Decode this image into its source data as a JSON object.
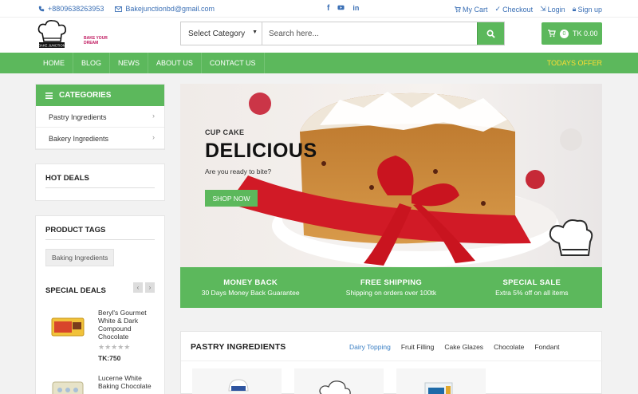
{
  "topbar": {
    "phone": "+8809638263953",
    "email": "Bakejunctionbd@gmail.com",
    "my_cart": "My Cart",
    "checkout": "Checkout",
    "login": "Login",
    "signup": "Sign up"
  },
  "header": {
    "logo_text": "BAKE YOUR DREAM",
    "category_select": "Select Category",
    "search_placeholder": "Search here...",
    "cart_count": "0",
    "cart_total": "TK 0.00"
  },
  "nav": {
    "items": [
      "HOME",
      "BLOG",
      "NEWS",
      "ABOUT US",
      "CONTACT US"
    ],
    "offer": "TODAYS OFFER"
  },
  "sidebar": {
    "categories_title": "CATEGORIES",
    "categories": [
      "Pastry Ingredients",
      "Bakery Ingredients"
    ],
    "hot_deals_title": "HOT DEALS",
    "product_tags_title": "PRODUCT TAGS",
    "tag": "Baking Ingredients",
    "special_deals_title": "SPECIAL DEALS",
    "deals": [
      {
        "name": "Beryl's Gourmet White & Dark Compound Chocolate",
        "rating": 0,
        "price": "TK:750"
      },
      {
        "name": "Lucerne White Baking Chocolate"
      }
    ]
  },
  "hero": {
    "subtitle": "CUP CAKE",
    "title": "DELICIOUS",
    "question": "Are you ready to bite?",
    "button": "SHOP NOW"
  },
  "features": [
    {
      "title": "MONEY BACK",
      "desc": "30 Days Money Back Guarantee"
    },
    {
      "title": "FREE SHIPPING",
      "desc": "Shipping on orders over 100tk"
    },
    {
      "title": "SPECIAL SALE",
      "desc": "Extra 5% off on all items"
    }
  ],
  "products": {
    "title": "PASTRY INGREDIENTS",
    "tabs": [
      "Dairy Topping",
      "Fruit Filling",
      "Cake Glazes",
      "Chocolate",
      "Fondant"
    ]
  },
  "colors": {
    "brand_green": "#5cb85c",
    "link_blue": "#3a6fb5",
    "offer_yellow": "#ffdd33"
  }
}
